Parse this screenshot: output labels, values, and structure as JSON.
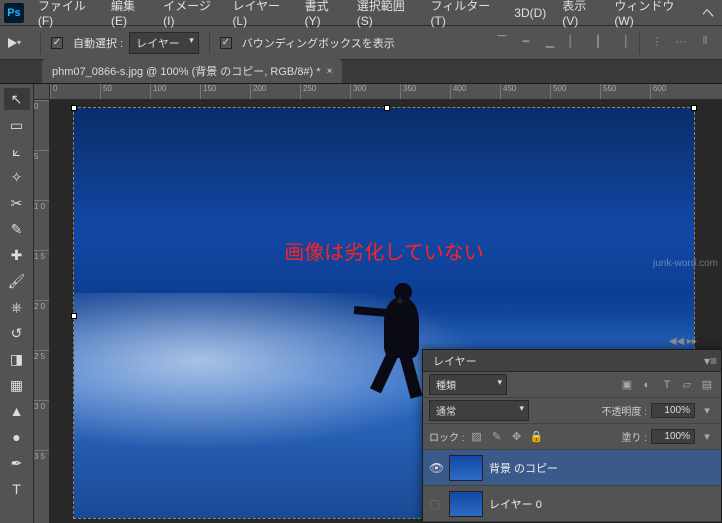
{
  "app": {
    "logo": "Ps"
  },
  "menu": {
    "items": [
      "ファイル(F)",
      "編集(E)",
      "イメージ(I)",
      "レイヤー(L)",
      "書式(Y)",
      "選択範囲(S)",
      "フィルター(T)",
      "3D(D)",
      "表示(V)",
      "ウィンドウ(W)",
      "ヘ"
    ]
  },
  "options": {
    "auto_select": "自動選択 :",
    "target": "レイヤー",
    "show_bbox": "バウンディングボックスを表示"
  },
  "tab": {
    "title": "phm07_0866-s.jpg @ 100% (背景 のコピー, RGB/8#) *",
    "close": "×"
  },
  "ruler": {
    "h": [
      "0",
      "50",
      "100",
      "150",
      "200",
      "250",
      "300",
      "350",
      "400",
      "450",
      "500",
      "550",
      "600"
    ],
    "v": [
      "0",
      "5",
      "1 0",
      "1 5",
      "2 0",
      "2 5",
      "3 0",
      "3 5"
    ]
  },
  "canvas": {
    "overlay_text": "画像は劣化していない"
  },
  "layers_panel": {
    "title": "レイヤー",
    "kind": "種類",
    "blend": "通常",
    "opacity_label": "不透明度 :",
    "opacity_value": "100%",
    "lock_label": "ロック :",
    "fill_label": "塗り :",
    "fill_value": "100%",
    "layers": [
      {
        "name": "背景 のコピー",
        "visible": true,
        "selected": true
      },
      {
        "name": "レイヤー 0",
        "visible": false,
        "selected": false
      }
    ]
  },
  "watermark": "junk-word.com"
}
